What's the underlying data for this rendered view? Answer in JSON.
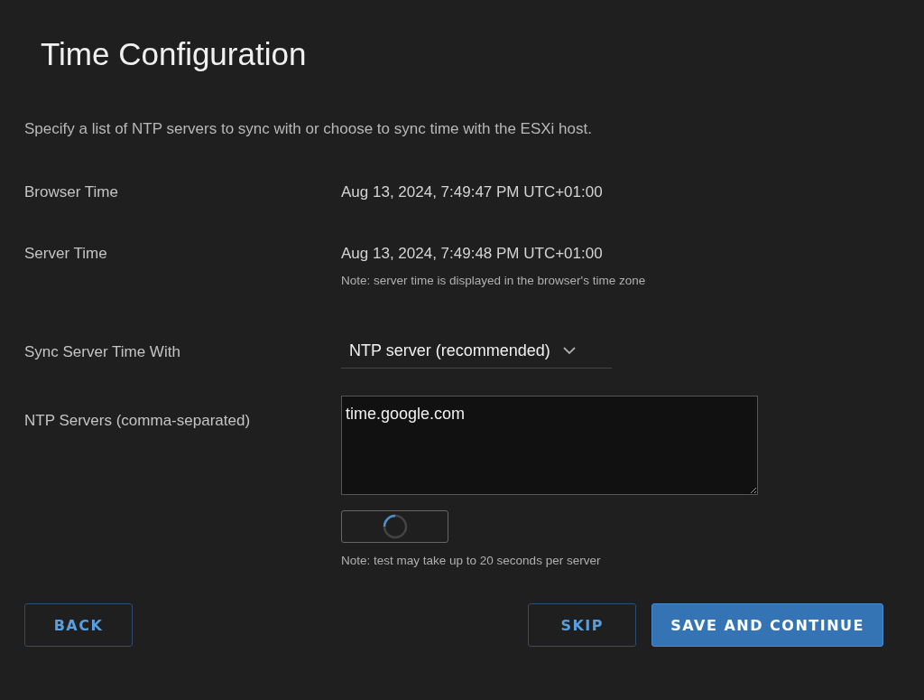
{
  "title": "Time Configuration",
  "description": "Specify a list of NTP servers to sync with or choose to sync time with the ESXi host.",
  "browser_time": {
    "label": "Browser Time",
    "value": "Aug 13, 2024, 7:49:47 PM UTC+01:00"
  },
  "server_time": {
    "label": "Server Time",
    "value": "Aug 13, 2024, 7:49:48 PM UTC+01:00",
    "note": "Note: server time is displayed in the browser's time zone"
  },
  "sync_with": {
    "label": "Sync Server Time With",
    "value": "NTP server (recommended)"
  },
  "ntp_servers": {
    "label": "NTP Servers (comma-separated)",
    "value": "time.google.com"
  },
  "test_button": {
    "loading": true,
    "note": "Note: test may take up to 20 seconds per server"
  },
  "footer": {
    "left_buttons": [
      {
        "label": "BACK",
        "kind": "outline"
      }
    ],
    "right_buttons": [
      {
        "label": "SKIP",
        "kind": "outline"
      },
      {
        "label": "SAVE AND CONTINUE",
        "kind": "primary"
      }
    ]
  }
}
